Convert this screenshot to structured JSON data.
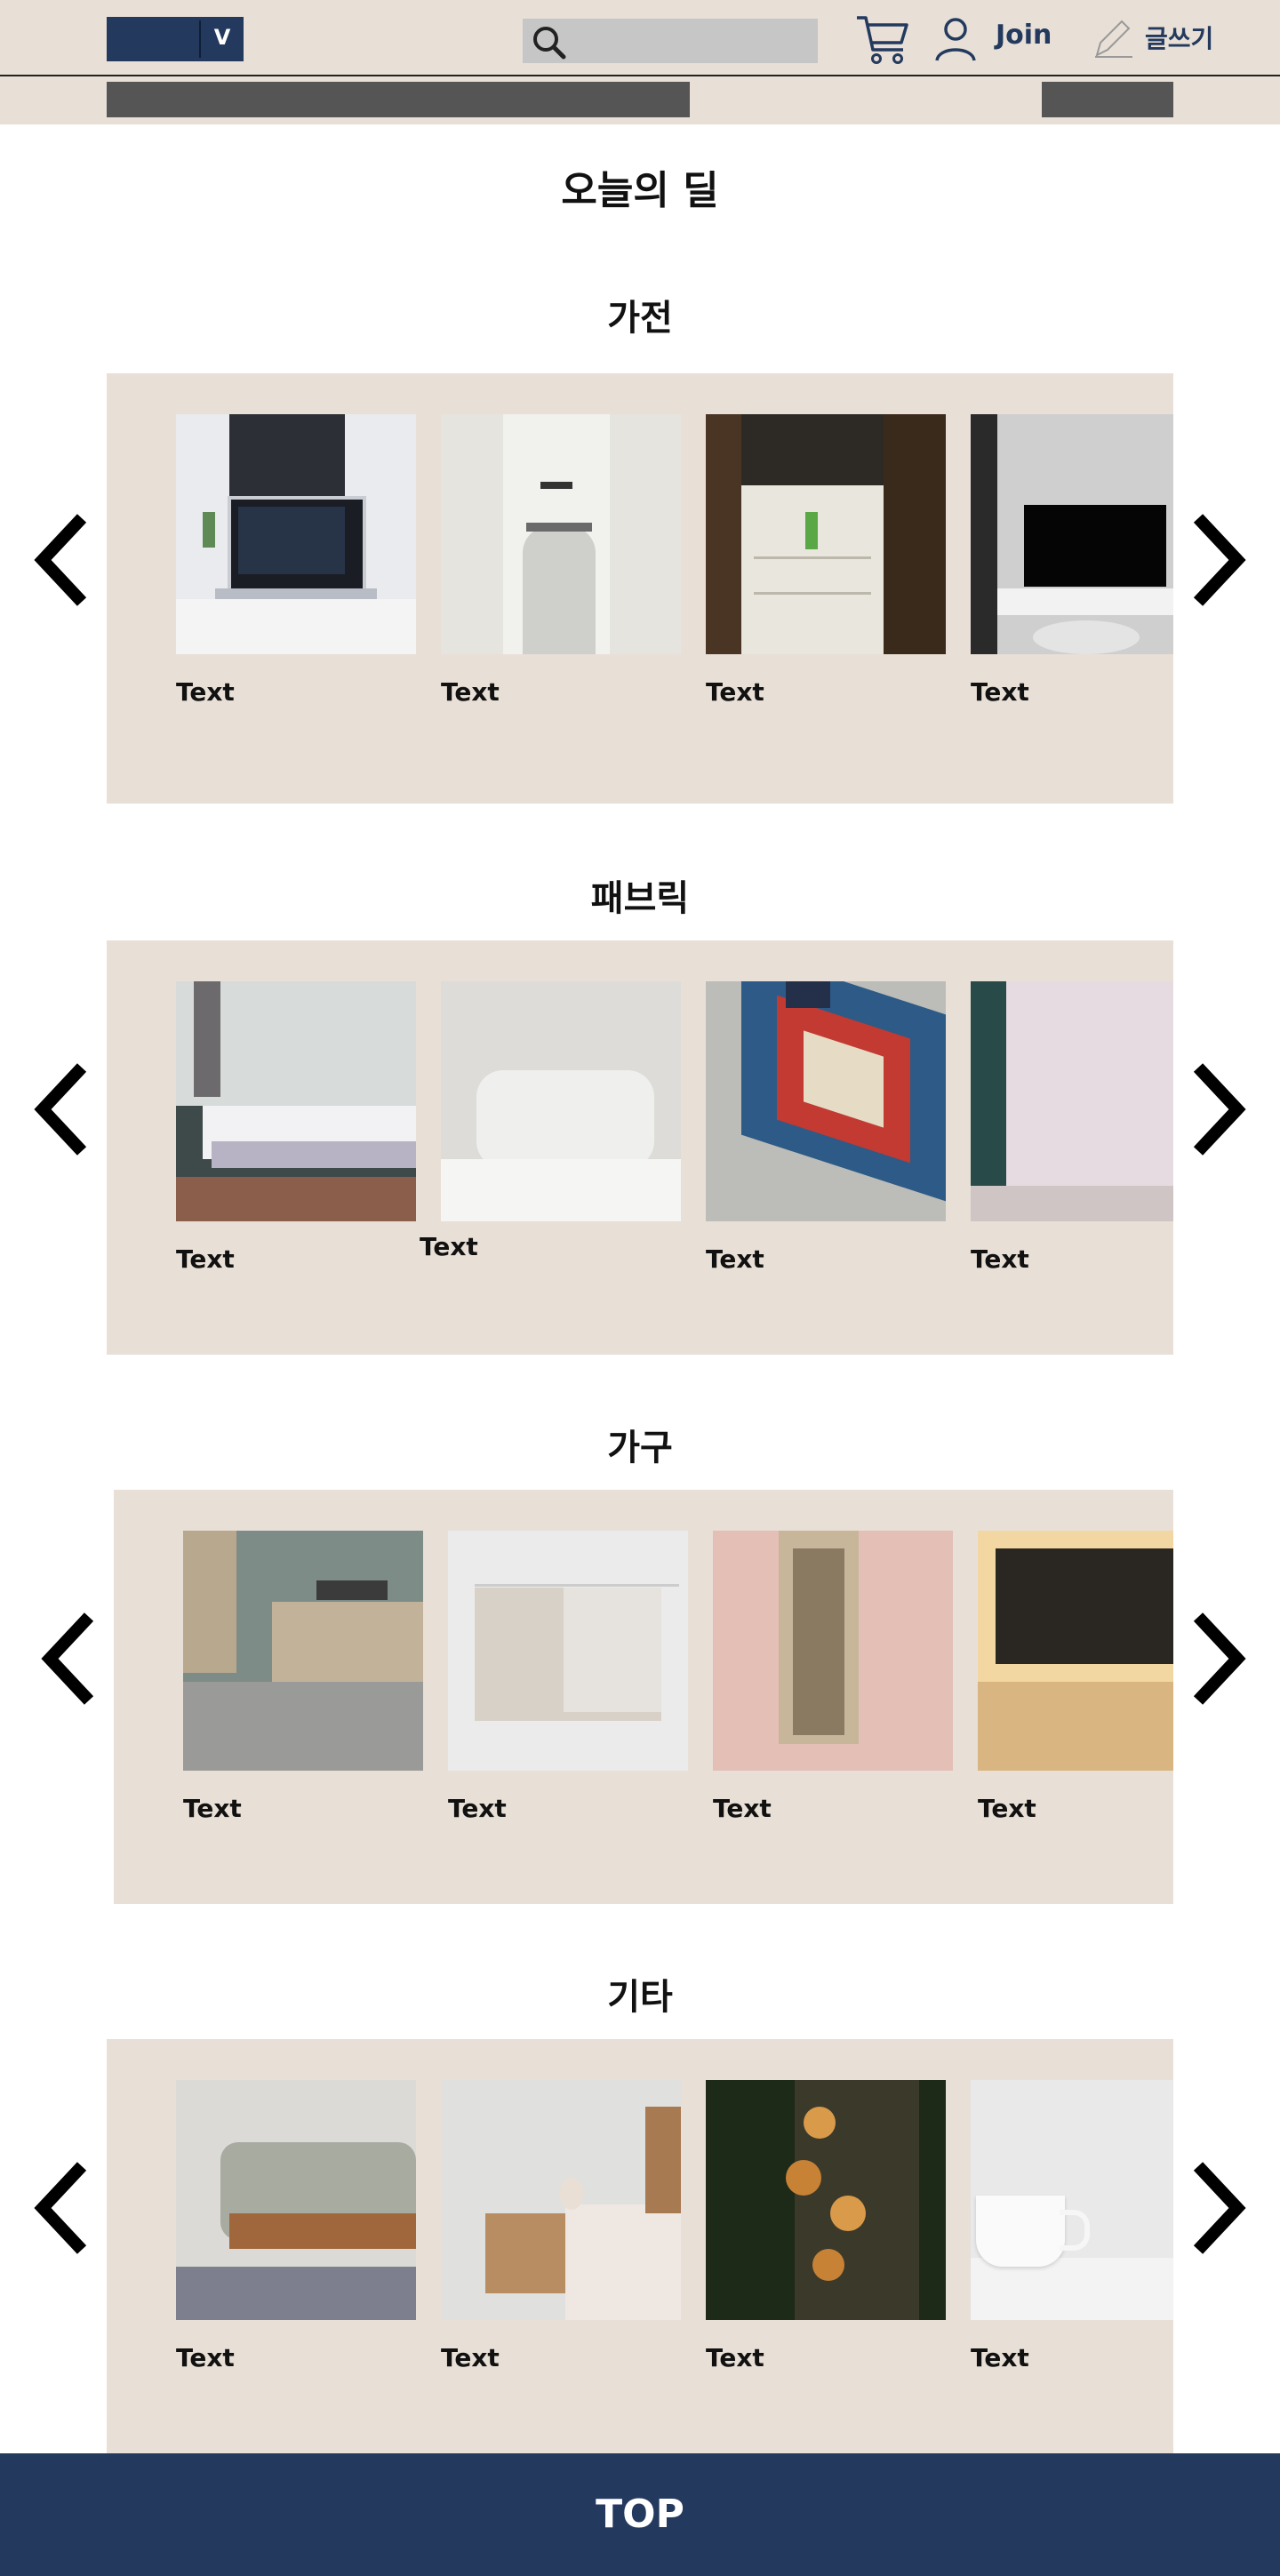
{
  "header": {
    "logo_letter": "V",
    "join_label": "Join",
    "write_label": "글쓰기",
    "icons": [
      "search-icon",
      "cart-icon",
      "user-icon",
      "pencil-icon"
    ],
    "colors": {
      "brand": "#233a5e",
      "beige": "#e8dfd6",
      "search": "#c6c6c6"
    }
  },
  "page_title": "오늘의 딜",
  "sections": [
    {
      "title": "가전",
      "items": [
        "Text",
        "Text",
        "Text",
        "Text"
      ]
    },
    {
      "title": "패브릭",
      "items": [
        "Text",
        "Text",
        "Text",
        "Text"
      ]
    },
    {
      "title": "가구",
      "items": [
        "Text",
        "Text",
        "Text",
        "Text"
      ]
    },
    {
      "title": "기타",
      "items": [
        "Text",
        "Text",
        "Text",
        "Text"
      ]
    }
  ],
  "footer": {
    "top_label": "TOP"
  }
}
